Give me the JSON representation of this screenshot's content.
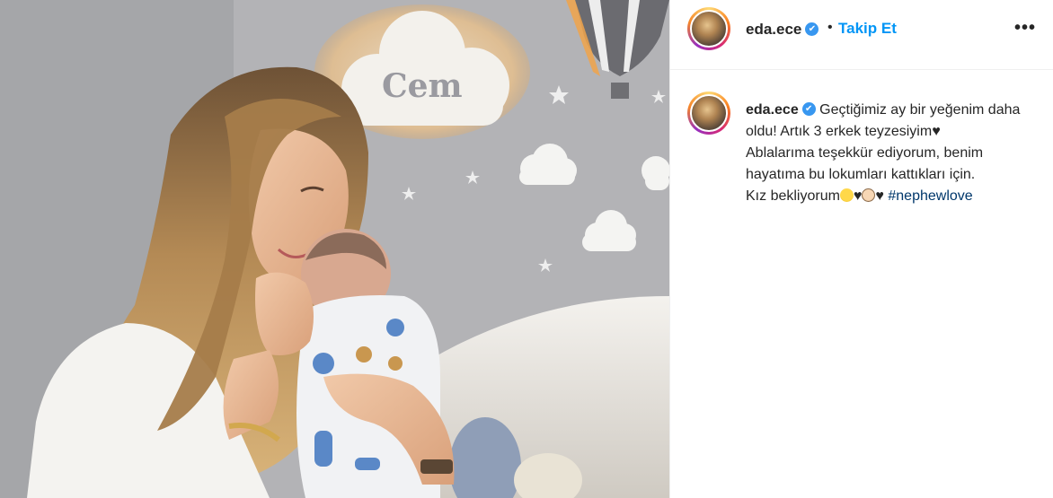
{
  "photo": {
    "description_alt": "",
    "cloud_label": "Cem"
  },
  "post": {
    "username": "eda.ece",
    "verified_icon": "✔",
    "separator": "•",
    "follow_label": "Takip Et",
    "more_label": "•••",
    "caption": {
      "username": "eda.ece",
      "line1": "Geçtiğimiz ay bir yeğenim daha oldu! Artık 3 erkek teyzesiyim♥",
      "line2": "Ablalarıma teşekkür ediyorum, benim hayatıma bu lokumları kattıkları için.",
      "line3_prefix": "Kız bekliyorum",
      "heart1": "♥",
      "heart2": "♥",
      "hashtag": "#nephewlove"
    }
  },
  "icons": {
    "verified": "verified-badge-icon",
    "more": "more-options-icon",
    "emoji1": "laughing-crying-emoji-icon",
    "emoji2": "baby-emoji-icon"
  },
  "colors": {
    "follow": "#0095f6",
    "verified": "#3897f0",
    "hashtag": "#00376b"
  }
}
